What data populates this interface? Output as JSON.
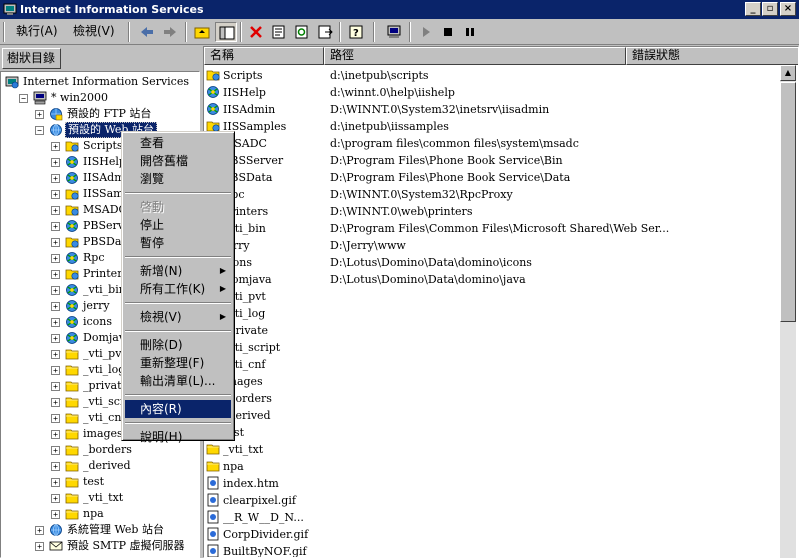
{
  "window": {
    "title": "Internet Information Services"
  },
  "menubar": {
    "action": "執行(A)",
    "view": "檢視(V)"
  },
  "tree_tab": "樹狀目錄",
  "tree": [
    {
      "label": "Internet Information Services",
      "icon": "iis-root-icon",
      "indent": 0,
      "expander": ""
    },
    {
      "label": "* win2000",
      "icon": "computer-icon",
      "indent": 1,
      "expander": "−"
    },
    {
      "label": "預設的 FTP 站台",
      "icon": "ftp-site-icon",
      "indent": 2,
      "expander": "+"
    },
    {
      "label": "預設的 Web 站台",
      "icon": "web-site-icon",
      "indent": 2,
      "expander": "−",
      "selected": true
    },
    {
      "label": "Scripts",
      "icon": "virtual-dir-icon",
      "indent": 3,
      "expander": "+"
    },
    {
      "label": "IISHelp",
      "icon": "web-app-icon",
      "indent": 3,
      "expander": "+"
    },
    {
      "label": "IISAdmin",
      "icon": "web-app-icon",
      "indent": 3,
      "expander": "+"
    },
    {
      "label": "IISSamples",
      "icon": "virtual-dir-icon",
      "indent": 3,
      "expander": "+"
    },
    {
      "label": "MSADC",
      "icon": "virtual-dir-icon",
      "indent": 3,
      "expander": "+"
    },
    {
      "label": "PBServer",
      "icon": "web-app-icon",
      "indent": 3,
      "expander": "+"
    },
    {
      "label": "PBSData",
      "icon": "virtual-dir-icon",
      "indent": 3,
      "expander": "+"
    },
    {
      "label": "Rpc",
      "icon": "web-app-icon",
      "indent": 3,
      "expander": "+"
    },
    {
      "label": "Printers",
      "icon": "virtual-dir-icon",
      "indent": 3,
      "expander": "+"
    },
    {
      "label": "_vti_bin",
      "icon": "web-app-icon",
      "indent": 3,
      "expander": "+"
    },
    {
      "label": "jerry",
      "icon": "web-app-icon",
      "indent": 3,
      "expander": "+"
    },
    {
      "label": "icons",
      "icon": "web-app-icon",
      "indent": 3,
      "expander": "+"
    },
    {
      "label": "Domjava",
      "icon": "web-app-icon",
      "indent": 3,
      "expander": "+"
    },
    {
      "label": "_vti_pvt",
      "icon": "folder-icon",
      "indent": 3,
      "expander": "+"
    },
    {
      "label": "_vti_log",
      "icon": "folder-icon",
      "indent": 3,
      "expander": "+"
    },
    {
      "label": "_private",
      "icon": "folder-icon",
      "indent": 3,
      "expander": "+"
    },
    {
      "label": "_vti_script",
      "icon": "folder-icon",
      "indent": 3,
      "expander": "+"
    },
    {
      "label": "_vti_cnf",
      "icon": "folder-icon",
      "indent": 3,
      "expander": "+"
    },
    {
      "label": "images",
      "icon": "folder-icon",
      "indent": 3,
      "expander": "+"
    },
    {
      "label": "_borders",
      "icon": "folder-icon",
      "indent": 3,
      "expander": "+"
    },
    {
      "label": "_derived",
      "icon": "folder-icon",
      "indent": 3,
      "expander": "+"
    },
    {
      "label": "test",
      "icon": "folder-icon",
      "indent": 3,
      "expander": "+"
    },
    {
      "label": "_vti_txt",
      "icon": "folder-icon",
      "indent": 3,
      "expander": "+"
    },
    {
      "label": "npa",
      "icon": "folder-icon",
      "indent": 3,
      "expander": "+"
    },
    {
      "label": "系統管理 Web 站台",
      "icon": "web-site-icon",
      "indent": 2,
      "expander": "+"
    },
    {
      "label": "預設 SMTP 虛擬伺服器",
      "icon": "smtp-icon",
      "indent": 2,
      "expander": "+"
    }
  ],
  "list": {
    "columns": [
      "名稱",
      "路徑",
      "錯誤狀態"
    ],
    "rows": [
      {
        "name": "Scripts",
        "path": "d:\\inetpub\\scripts",
        "icon": "virtual-dir-icon"
      },
      {
        "name": "IISHelp",
        "path": "d:\\winnt.0\\help\\iishelp",
        "icon": "web-app-icon"
      },
      {
        "name": "IISAdmin",
        "path": "D:\\WINNT.0\\System32\\inetsrv\\iisadmin",
        "icon": "web-app-icon"
      },
      {
        "name": "IISSamples",
        "path": "d:\\inetpub\\iissamples",
        "icon": "virtual-dir-icon"
      },
      {
        "name": "MSADC",
        "path": "d:\\program files\\common files\\system\\msadc",
        "icon": "virtual-dir-icon"
      },
      {
        "name": "PBSServer",
        "path": "D:\\Program Files\\Phone Book Service\\Bin",
        "icon": "web-app-icon"
      },
      {
        "name": "PBSData",
        "path": "D:\\Program Files\\Phone Book Service\\Data",
        "icon": "virtual-dir-icon"
      },
      {
        "name": "Rpc",
        "path": "D:\\WINNT.0\\System32\\RpcProxy",
        "icon": "web-app-icon"
      },
      {
        "name": "Printers",
        "path": "D:\\WINNT.0\\web\\printers",
        "icon": "virtual-dir-icon"
      },
      {
        "name": "_vti_bin",
        "path": "D:\\Program Files\\Common Files\\Microsoft Shared\\Web Ser...",
        "icon": "web-app-icon"
      },
      {
        "name": "jerry",
        "path": "D:\\Jerry\\www",
        "icon": "web-app-icon"
      },
      {
        "name": "icons",
        "path": "D:\\Lotus\\Domino\\Data\\domino\\icons",
        "icon": "web-app-icon"
      },
      {
        "name": "Domjava",
        "path": "D:\\Lotus\\Domino\\Data\\domino\\java",
        "icon": "web-app-icon"
      },
      {
        "name": "_vti_pvt",
        "path": "",
        "icon": "folder-icon"
      },
      {
        "name": "_vti_log",
        "path": "",
        "icon": "folder-icon"
      },
      {
        "name": "_private",
        "path": "",
        "icon": "folder-icon"
      },
      {
        "name": "_vti_script",
        "path": "",
        "icon": "folder-icon"
      },
      {
        "name": "_vti_cnf",
        "path": "",
        "icon": "folder-icon"
      },
      {
        "name": "images",
        "path": "",
        "icon": "folder-icon"
      },
      {
        "name": "_borders",
        "path": "",
        "icon": "folder-icon"
      },
      {
        "name": "_derived",
        "path": "",
        "icon": "folder-icon"
      },
      {
        "name": "test",
        "path": "",
        "icon": "folder-icon"
      },
      {
        "name": "_vti_txt",
        "path": "",
        "icon": "folder-icon"
      },
      {
        "name": "npa",
        "path": "",
        "icon": "folder-icon"
      },
      {
        "name": "index.htm",
        "path": "",
        "icon": "file-icon"
      },
      {
        "name": "clearpixel.gif",
        "path": "",
        "icon": "file-icon"
      },
      {
        "name": "__R_W__D_N...",
        "path": "",
        "icon": "file-icon"
      },
      {
        "name": "CorpDivider.gif",
        "path": "",
        "icon": "file-icon"
      },
      {
        "name": "BuiltByNOF.gif",
        "path": "",
        "icon": "file-icon"
      }
    ]
  },
  "context_menu": [
    {
      "type": "item",
      "label": "查看"
    },
    {
      "type": "item",
      "label": "開啓舊檔"
    },
    {
      "type": "item",
      "label": "瀏覽"
    },
    {
      "type": "sep"
    },
    {
      "type": "item",
      "label": "啓動",
      "disabled": true
    },
    {
      "type": "item",
      "label": "停止"
    },
    {
      "type": "item",
      "label": "暫停"
    },
    {
      "type": "sep"
    },
    {
      "type": "item",
      "label": "新增(N)",
      "submenu": true
    },
    {
      "type": "item",
      "label": "所有工作(K)",
      "submenu": true
    },
    {
      "type": "sep"
    },
    {
      "type": "item",
      "label": "檢視(V)",
      "submenu": true
    },
    {
      "type": "sep"
    },
    {
      "type": "item",
      "label": "刪除(D)"
    },
    {
      "type": "item",
      "label": "重新整理(F)"
    },
    {
      "type": "item",
      "label": "輸出清單(L)..."
    },
    {
      "type": "sep"
    },
    {
      "type": "item",
      "label": "內容(R)",
      "highlighted": true
    },
    {
      "type": "sep"
    },
    {
      "type": "item",
      "label": "說明(H)"
    }
  ],
  "colors": {
    "selection": "#0a246a",
    "face": "#c0c0c0"
  }
}
